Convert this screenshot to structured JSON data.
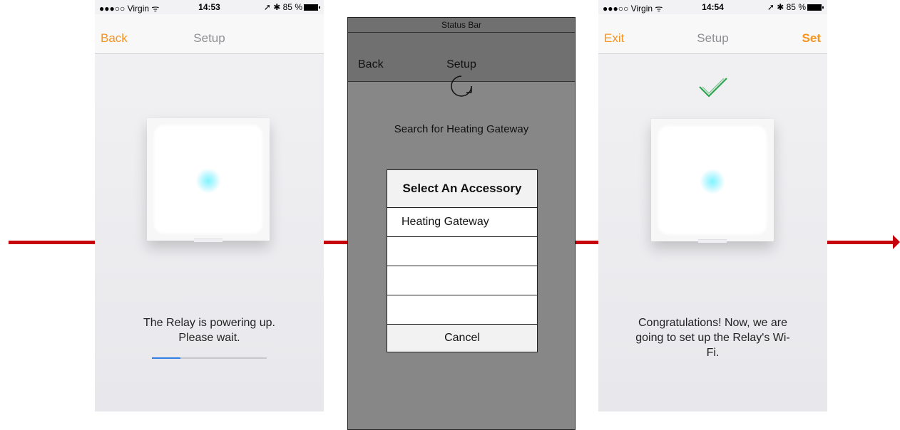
{
  "flow": {
    "arrow_color": "#c5000b"
  },
  "screen1": {
    "status": {
      "carrier": "●●●○○ Virgin ᯤ",
      "time": "14:53",
      "battery": "➚ ✱ 85 %"
    },
    "nav": {
      "back": "Back",
      "title": "Setup"
    },
    "message_line1": "The Relay is powering up.",
    "message_line2": "Please wait.",
    "progress": 0.25
  },
  "screen2": {
    "status_bar": "Status Bar",
    "nav": {
      "back": "Back",
      "title": "Setup"
    },
    "spinner_icon": "refresh-icon",
    "search_text": "Search for Heating Gateway",
    "dialog": {
      "title": "Select An Accessory",
      "items": [
        "Heating Gateway",
        "",
        "",
        ""
      ],
      "cancel": "Cancel"
    }
  },
  "screen3": {
    "status": {
      "carrier": "●●●○○ Virgin ᯤ",
      "time": "14:54",
      "battery": "➚ ✱ 85 %"
    },
    "nav": {
      "left": "Exit",
      "title": "Setup",
      "right": "Set"
    },
    "check_icon": "checkmark-icon",
    "message_line1": "Congratulations! Now, we are",
    "message_line2": "going to set up the Relay's Wi-",
    "message_line3": "Fi."
  },
  "colors": {
    "accent": "#f7931e",
    "progress": "#2f7fe5",
    "check": "#2ea44f"
  }
}
